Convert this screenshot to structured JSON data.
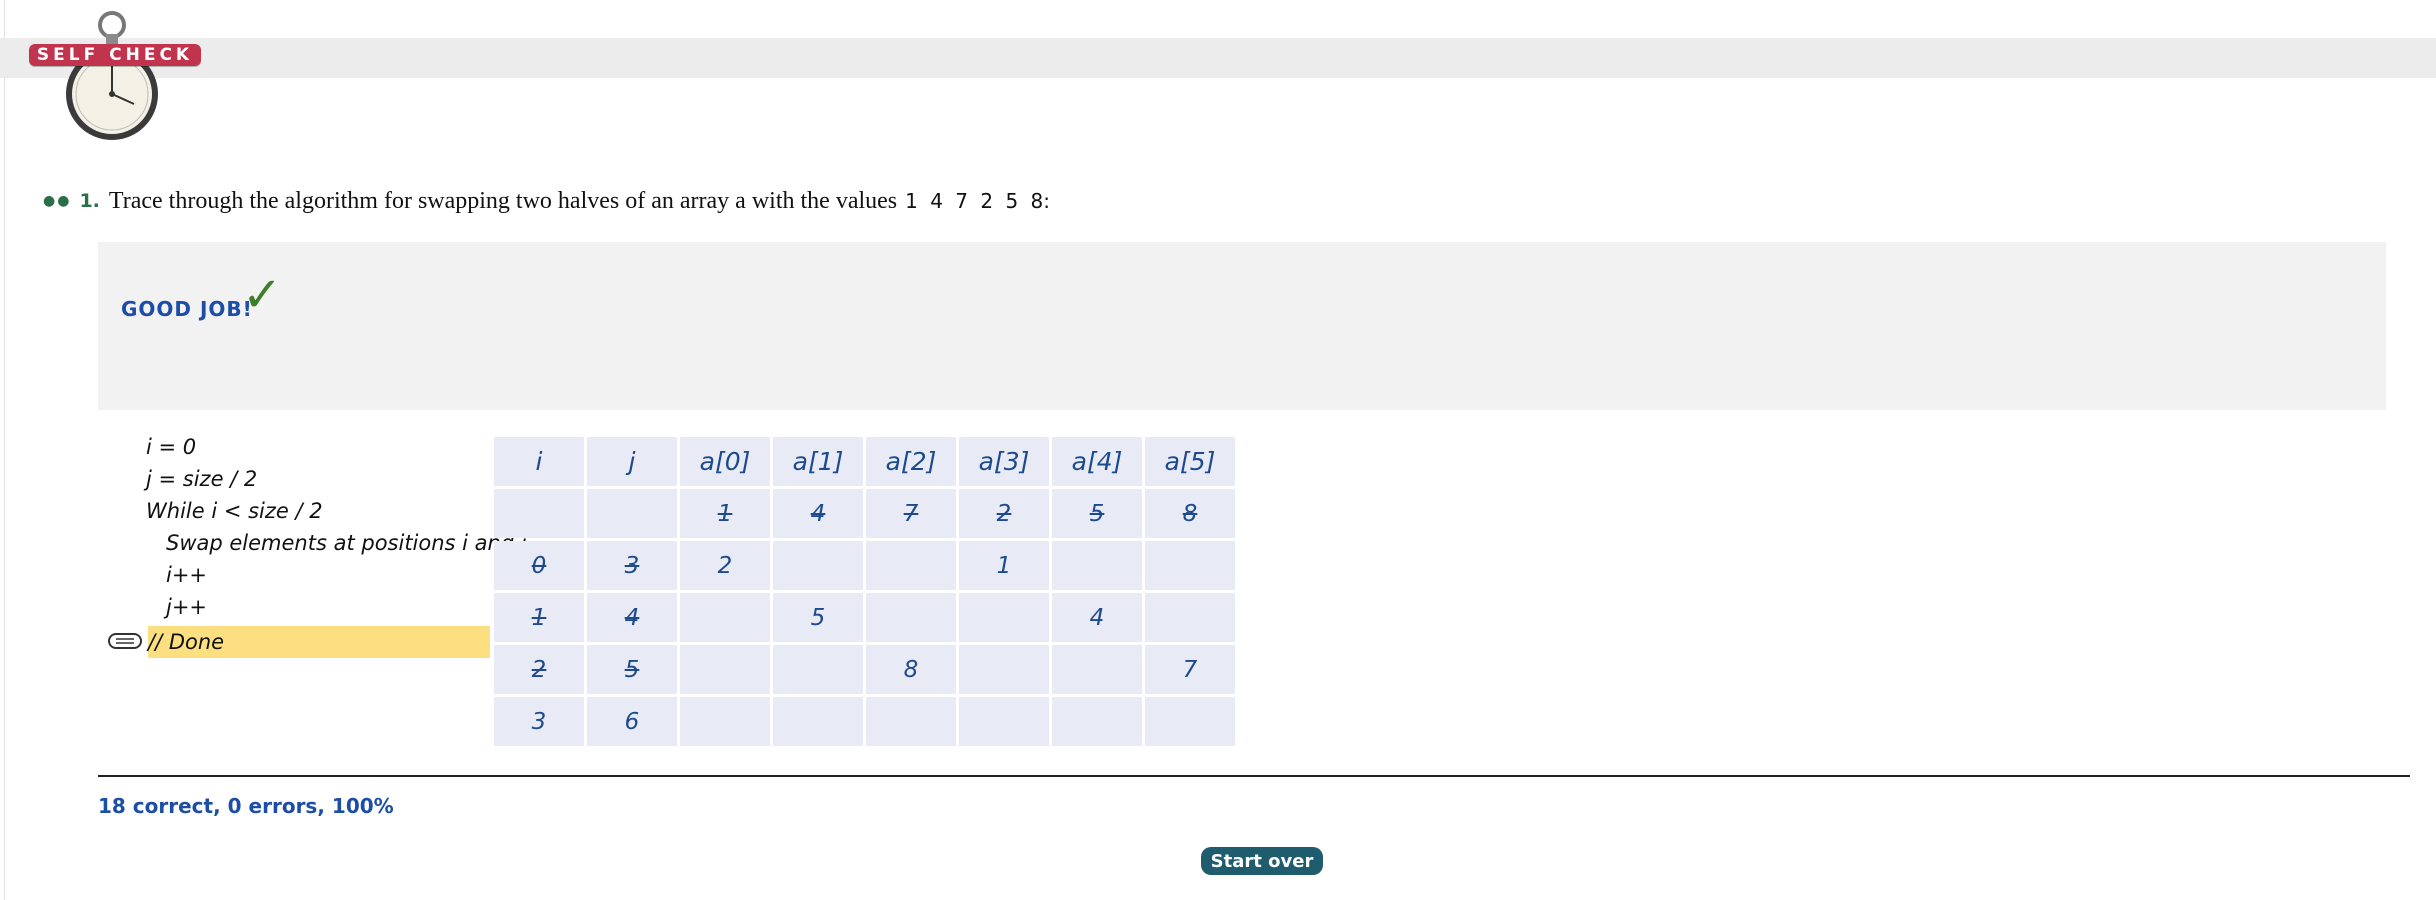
{
  "header": {
    "badge_label": "SELF CHECK",
    "badge_color": "#c0344e"
  },
  "question": {
    "number": "1.",
    "text": "Trace through the algorithm for swapping two halves of an array a with the values",
    "values": "1 4 7 2 5 8:"
  },
  "feedback": {
    "message": "GOOD JOB!",
    "check_glyph": "✓"
  },
  "pseudocode": {
    "lines": [
      "i = 0",
      "j = size / 2",
      "While i < size / 2",
      "Swap elements at positions i and j",
      "i++",
      "j++",
      "// Done"
    ],
    "current_line_index": 6
  },
  "trace_table": {
    "headers": [
      "i",
      "j",
      "a[0]",
      "a[1]",
      "a[2]",
      "a[3]",
      "a[4]",
      "a[5]"
    ],
    "rows": [
      [
        {
          "v": ""
        },
        {
          "v": ""
        },
        {
          "v": "1",
          "s": true
        },
        {
          "v": "4",
          "s": true
        },
        {
          "v": "7",
          "s": true
        },
        {
          "v": "2",
          "s": true
        },
        {
          "v": "5",
          "s": true
        },
        {
          "v": "8",
          "s": true
        }
      ],
      [
        {
          "v": "0",
          "s": true
        },
        {
          "v": "3",
          "s": true
        },
        {
          "v": "2"
        },
        {
          "v": ""
        },
        {
          "v": ""
        },
        {
          "v": "1"
        },
        {
          "v": ""
        },
        {
          "v": ""
        }
      ],
      [
        {
          "v": "1",
          "s": true
        },
        {
          "v": "4",
          "s": true
        },
        {
          "v": ""
        },
        {
          "v": "5"
        },
        {
          "v": ""
        },
        {
          "v": ""
        },
        {
          "v": "4"
        },
        {
          "v": ""
        }
      ],
      [
        {
          "v": "2",
          "s": true
        },
        {
          "v": "5",
          "s": true
        },
        {
          "v": ""
        },
        {
          "v": ""
        },
        {
          "v": "8"
        },
        {
          "v": ""
        },
        {
          "v": ""
        },
        {
          "v": "7"
        }
      ],
      [
        {
          "v": "3"
        },
        {
          "v": "6"
        },
        {
          "v": ""
        },
        {
          "v": ""
        },
        {
          "v": ""
        },
        {
          "v": ""
        },
        {
          "v": ""
        },
        {
          "v": ""
        }
      ]
    ]
  },
  "score": {
    "text": "18 correct, 0 errors, 100%"
  },
  "actions": {
    "start_over_label": "Start over"
  },
  "colors": {
    "accent_blue": "#1d4ea6",
    "highlight": "#fbdf80",
    "cell_bg": "#e8ebf5",
    "button_bg": "#1f5c6e"
  }
}
